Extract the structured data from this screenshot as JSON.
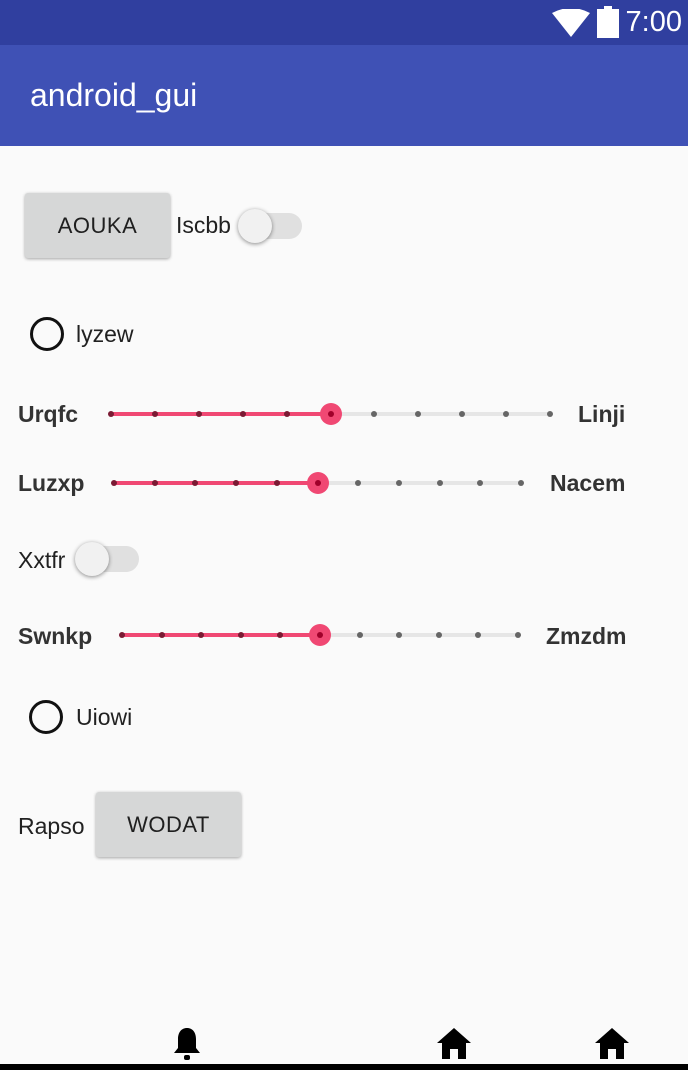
{
  "status_bar": {
    "time": "7:00",
    "icons": [
      "wifi-icon",
      "battery-icon"
    ]
  },
  "app_bar": {
    "title": "android_gui"
  },
  "row1": {
    "button_label": "AOUKA",
    "switch_label": "Iscbb",
    "switch_on": false
  },
  "radio1": {
    "label": "lyzew",
    "checked": false
  },
  "slider1": {
    "left_label": "Urqfc",
    "right_label": "Linji",
    "steps": 10,
    "value": 5
  },
  "slider2": {
    "left_label": "Luzxp",
    "right_label": "Nacem",
    "steps": 10,
    "value": 5
  },
  "switch2": {
    "label": "Xxtfr",
    "on": false
  },
  "slider3": {
    "left_label": "Swnkp",
    "right_label": "Zmzdm",
    "steps": 10,
    "value": 5
  },
  "radio2": {
    "label": "Uiowi",
    "checked": false
  },
  "row_last": {
    "label": "Rapso",
    "button_label": "WODAT"
  },
  "bottom_icons": [
    "bell-icon",
    "home-icon",
    "home-icon"
  ],
  "colors": {
    "primary": "#3f51b5",
    "primary_dark": "#303f9f",
    "accent": "#f04873"
  }
}
